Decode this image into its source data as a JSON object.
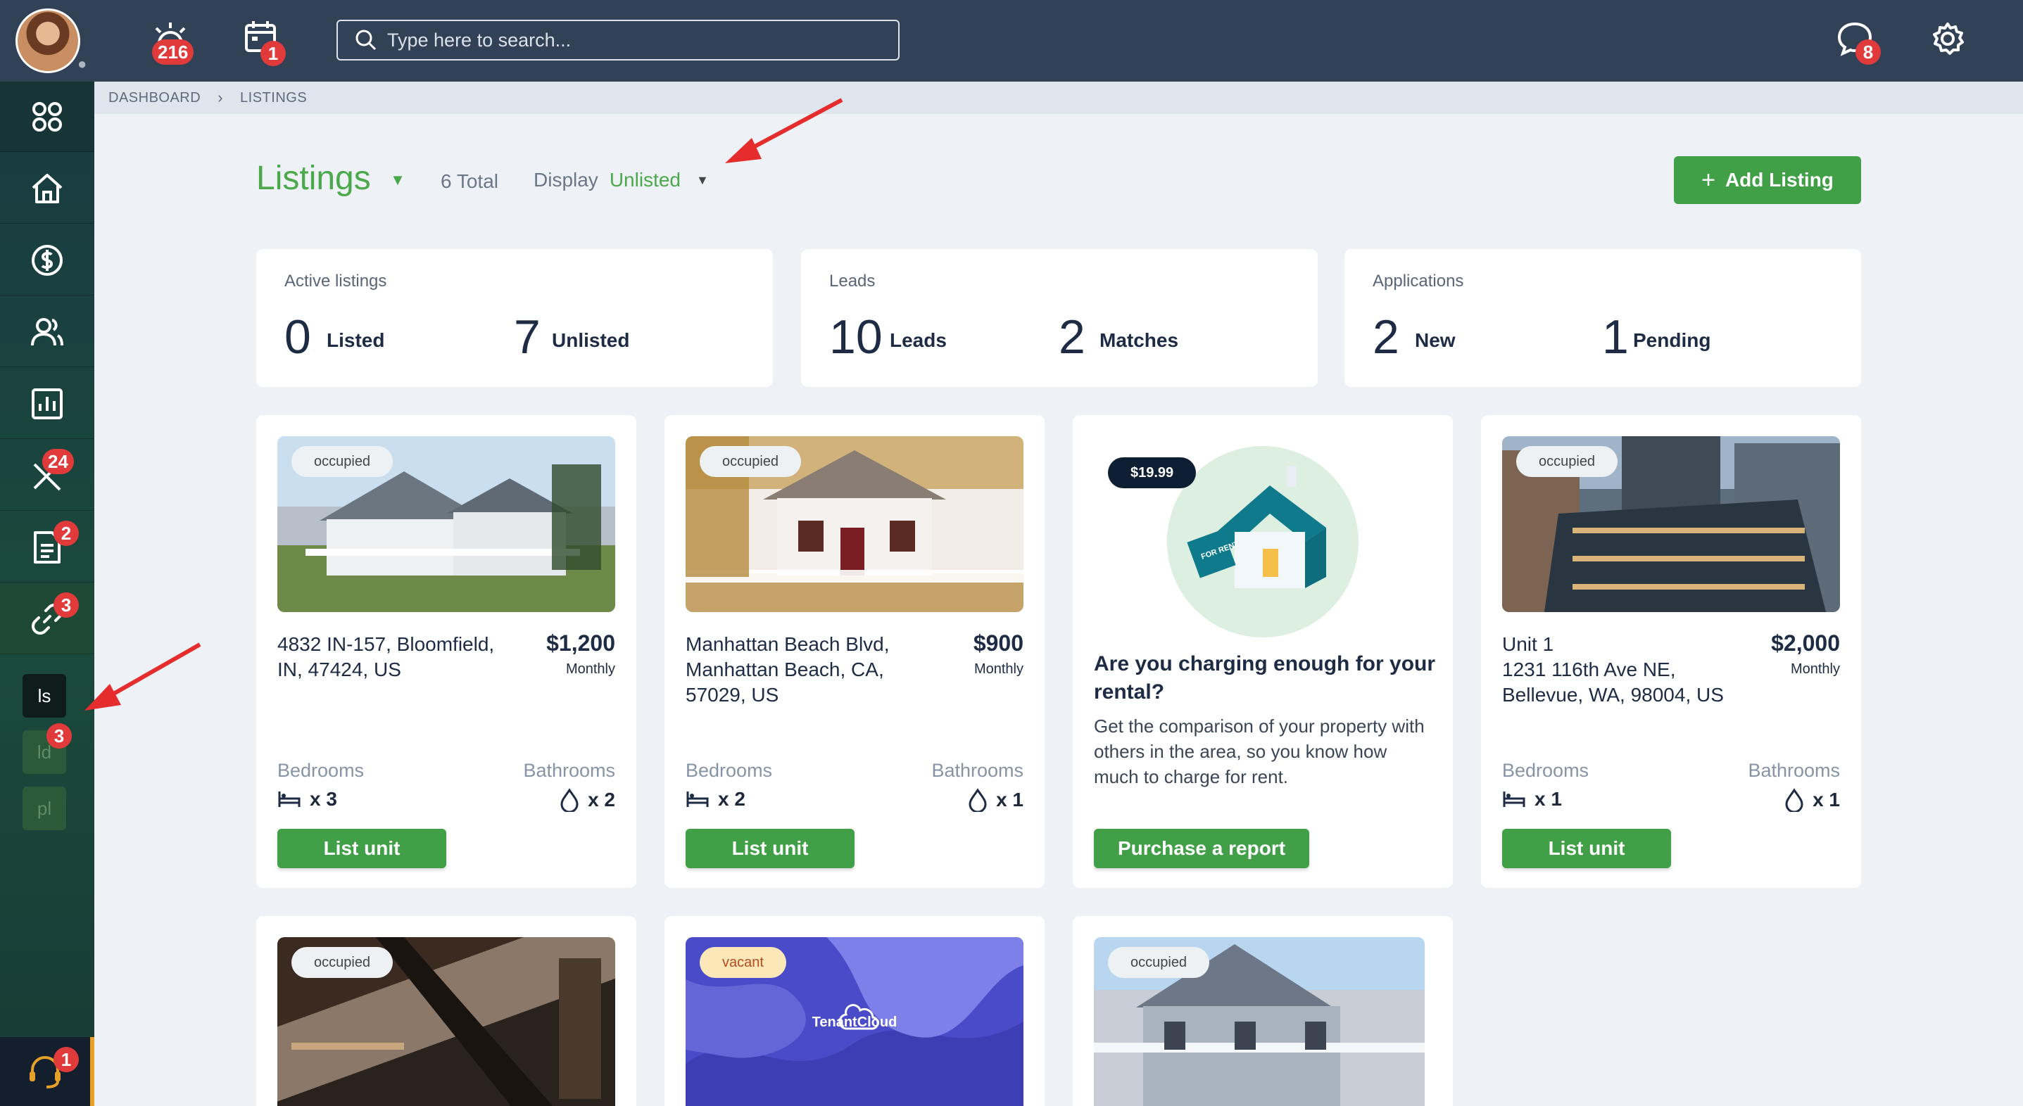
{
  "topbar": {
    "notifications_count": "216",
    "calendar_count": "1",
    "search_placeholder": "Type here to search...",
    "messages_count": "8"
  },
  "sidebar": {
    "maintenance_badge": "24",
    "documents_badge": "2",
    "listings_badge": "3",
    "sub_items": [
      "ls",
      "ld",
      "pl"
    ],
    "ld_badge": "3",
    "support_badge": "1"
  },
  "breadcrumb": {
    "home": "DASHBOARD",
    "current": "LISTINGS"
  },
  "header": {
    "title": "Listings",
    "total": "6 Total",
    "display_label": "Display",
    "display_value": "Unlisted",
    "add_button": "Add Listing"
  },
  "stats": [
    {
      "label": "Active listings",
      "a_num": "0",
      "a_word": "Listed",
      "b_num": "7",
      "b_word": "Unlisted"
    },
    {
      "label": "Leads",
      "a_num": "10",
      "a_word": "Leads",
      "b_num": "2",
      "b_word": "Matches"
    },
    {
      "label": "Applications",
      "a_num": "2",
      "a_word": "New",
      "b_num": "1",
      "b_word": "Pending"
    }
  ],
  "listings": [
    {
      "tag": "occupied",
      "address": "4832 IN-157, Bloomfield, IN, 47424, US",
      "price": "$1,200",
      "period": "Monthly",
      "bed_label": "Bedrooms",
      "bath_label": "Bathrooms",
      "beds": "x 3",
      "baths": "x 2",
      "button": "List unit"
    },
    {
      "tag": "occupied",
      "address": "Manhattan Beach Blvd, Manhattan Beach, CA, 57029, US",
      "price": "$900",
      "period": "Monthly",
      "bed_label": "Bedrooms",
      "bath_label": "Bathrooms",
      "beds": "x 2",
      "baths": "x 1",
      "button": "List unit"
    },
    {
      "tag": "occupied",
      "address_line1": "Unit 1",
      "address": "1231 116th Ave NE, Bellevue, WA, 98004, US",
      "price": "$2,000",
      "period": "Monthly",
      "bed_label": "Bedrooms",
      "bath_label": "Bathrooms",
      "beds": "x 1",
      "baths": "x 1",
      "button": "List unit"
    }
  ],
  "promo": {
    "price_tag": "$19.99",
    "sign_text": "FOR RENT",
    "heading": "Are you charging enough for your rental?",
    "body": "Get the comparison of your property with others in the area, so you know how much to charge for rent.",
    "button": "Purchase a report"
  },
  "bottom_cards": [
    {
      "tag": "occupied"
    },
    {
      "tag": "vacant",
      "logo_text": "TenantCloud"
    },
    {
      "tag": "occupied"
    }
  ]
}
